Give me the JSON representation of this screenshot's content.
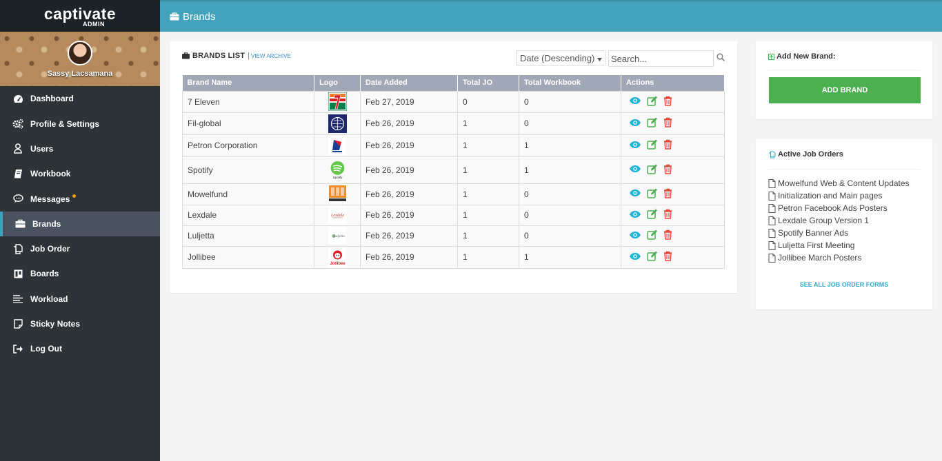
{
  "brand": {
    "logo_text": "captivate",
    "logo_sub": "ADMIN"
  },
  "user": {
    "name": "Sassy Lacsamana"
  },
  "sidebar": {
    "items": [
      {
        "label": "Dashboard",
        "icon": "dashboard-icon"
      },
      {
        "label": "Profile & Settings",
        "icon": "gears-icon"
      },
      {
        "label": "Users",
        "icon": "user-icon"
      },
      {
        "label": "Workbook",
        "icon": "book-icon"
      },
      {
        "label": "Messages",
        "icon": "comment-icon",
        "badge": true
      },
      {
        "label": "Brands",
        "icon": "briefcase-icon",
        "active": true
      },
      {
        "label": "Job Order",
        "icon": "copy-icon"
      },
      {
        "label": "Boards",
        "icon": "board-icon"
      },
      {
        "label": "Workload",
        "icon": "list-icon"
      },
      {
        "label": "Sticky Notes",
        "icon": "note-icon"
      },
      {
        "label": "Log Out",
        "icon": "sign-out-icon"
      }
    ]
  },
  "header": {
    "title": "Brands"
  },
  "brands_list": {
    "title": "BRANDS LIST",
    "archive_link": "VIEW ARCHIVE",
    "sort_selected": "Date (Descending)",
    "search_placeholder": "Search...",
    "columns": [
      "Brand Name",
      "Logo",
      "Date Added",
      "Total JO",
      "Total Workbook",
      "Actions"
    ],
    "rows": [
      {
        "name": "7 Eleven",
        "logo": "seven-eleven-logo",
        "date": "Feb 27, 2019",
        "total_jo": "0",
        "total_workbook": "0"
      },
      {
        "name": "Fil-global",
        "logo": "fil-global-logo",
        "date": "Feb 26, 2019",
        "total_jo": "1",
        "total_workbook": "0"
      },
      {
        "name": "Petron Corporation",
        "logo": "petron-logo",
        "date": "Feb 26, 2019",
        "total_jo": "1",
        "total_workbook": "1"
      },
      {
        "name": "Spotify",
        "logo": "spotify-logo",
        "date": "Feb 26, 2019",
        "total_jo": "1",
        "total_workbook": "1"
      },
      {
        "name": "Mowelfund",
        "logo": "mowelfund-logo",
        "date": "Feb 26, 2019",
        "total_jo": "1",
        "total_workbook": "0"
      },
      {
        "name": "Lexdale",
        "logo": "lexdale-logo",
        "date": "Feb 26, 2019",
        "total_jo": "1",
        "total_workbook": "0"
      },
      {
        "name": "Luljetta",
        "logo": "luljetta-logo",
        "date": "Feb 26, 2019",
        "total_jo": "1",
        "total_workbook": "0"
      },
      {
        "name": "Jollibee",
        "logo": "jollibee-logo",
        "date": "Feb 26, 2019",
        "total_jo": "1",
        "total_workbook": "1"
      }
    ]
  },
  "add_brand": {
    "title": "Add New Brand:",
    "button": "ADD BRAND"
  },
  "job_orders": {
    "title": "Active Job Orders",
    "items": [
      "Mowelfund Web & Content Updates",
      "Initialization and Main pages",
      "Petron Facebook Ads Posters",
      "Lexdale Group Version 1",
      "Spotify Banner Ads",
      "Luljetta First Meeting",
      "Jollibee March Posters"
    ],
    "see_all": "SEE ALL JOB ORDER FORMS"
  },
  "colors": {
    "topbar": "#45a2bd",
    "sidebar": "#2e3338",
    "table_header": "#a0a7b6",
    "add_button": "#4cb050",
    "view": "#1fb5d4",
    "edit": "#4cb050",
    "delete": "#e74c3c"
  }
}
